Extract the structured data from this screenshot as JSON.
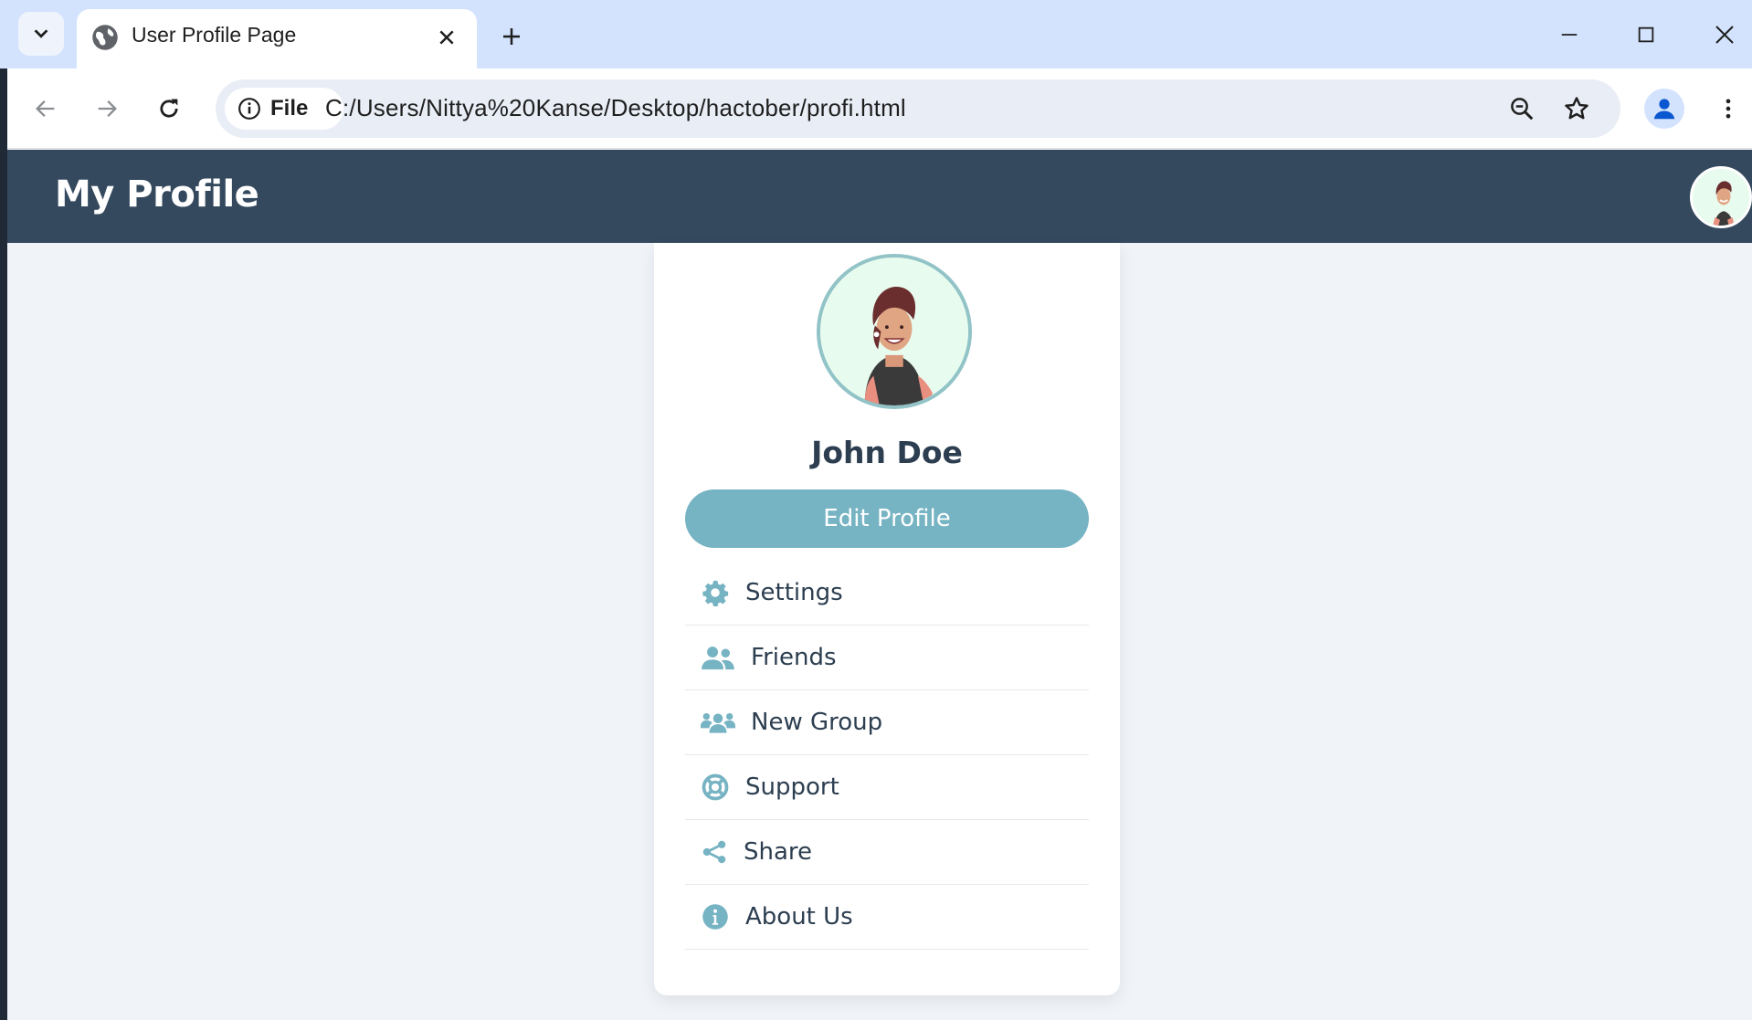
{
  "browser": {
    "tab_title": "User Profile Page",
    "site_chip_label": "File",
    "url": "C:/Users/Nittya%20Kanse/Desktop/hactober/profi.html",
    "icons": {
      "tab_menu": "chevron-down-icon",
      "favicon": "globe-icon",
      "tab_close": "close-icon",
      "new_tab": "plus-icon",
      "minimize": "minimize-icon",
      "maximize": "maximize-icon",
      "close_window": "close-icon",
      "back": "arrow-left-icon",
      "forward": "arrow-right-icon",
      "reload": "reload-icon",
      "site_info": "info-icon",
      "zoom": "zoom-out-icon",
      "bookmark": "star-icon",
      "profile": "person-icon",
      "more": "more-vert-icon"
    }
  },
  "header": {
    "title": "My Profile"
  },
  "profile": {
    "name": "John Doe",
    "edit_button": "Edit Profile"
  },
  "menu": {
    "items": [
      {
        "label": "Settings",
        "icon": "gear-icon"
      },
      {
        "label": "Friends",
        "icon": "user-group-icon"
      },
      {
        "label": "New Group",
        "icon": "users-icon"
      },
      {
        "label": "Support",
        "icon": "life-ring-icon"
      },
      {
        "label": "Share",
        "icon": "share-icon"
      },
      {
        "label": "About Us",
        "icon": "info-circle-icon"
      }
    ]
  },
  "colors": {
    "header_bg": "#34495e",
    "accent": "#76b3c3",
    "page_bg": "#f0f4f8",
    "text_dark": "#2c3e50"
  }
}
